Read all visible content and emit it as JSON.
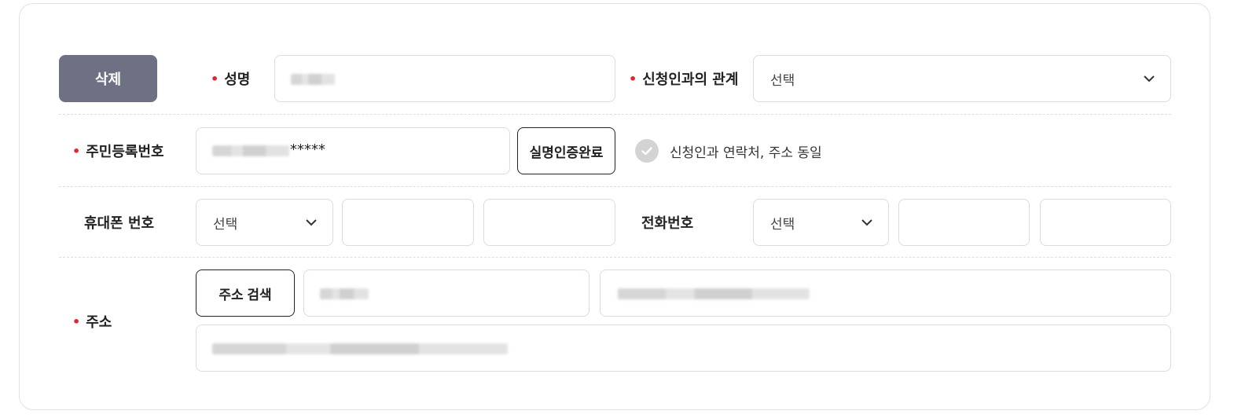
{
  "form": {
    "delete_button": "삭제",
    "name": {
      "label": "성명",
      "value": ""
    },
    "relation": {
      "label": "신청인과의 관계",
      "selected": "선택"
    },
    "rrn": {
      "label": "주민등록번호",
      "masked_suffix": "*****",
      "verify_button": "실명인증완료"
    },
    "same_as_applicant": {
      "label": "신청인과 연락처, 주소 동일",
      "checked": false
    },
    "mobile": {
      "label": "휴대폰 번호",
      "prefix_selected": "선택",
      "middle": "",
      "last": ""
    },
    "phone": {
      "label": "전화번호",
      "prefix_selected": "선택",
      "middle": "",
      "last": ""
    },
    "address": {
      "label": "주소",
      "search_button": "주소 검색",
      "zipcode": "",
      "address1": "",
      "address2": ""
    }
  },
  "icons": {
    "dropdown": "chevron-down-icon",
    "check": "check-circle-icon"
  },
  "colors": {
    "required_marker": "#e0262f",
    "delete_button_bg": "#6e7084",
    "border": "#dcdcdc"
  }
}
